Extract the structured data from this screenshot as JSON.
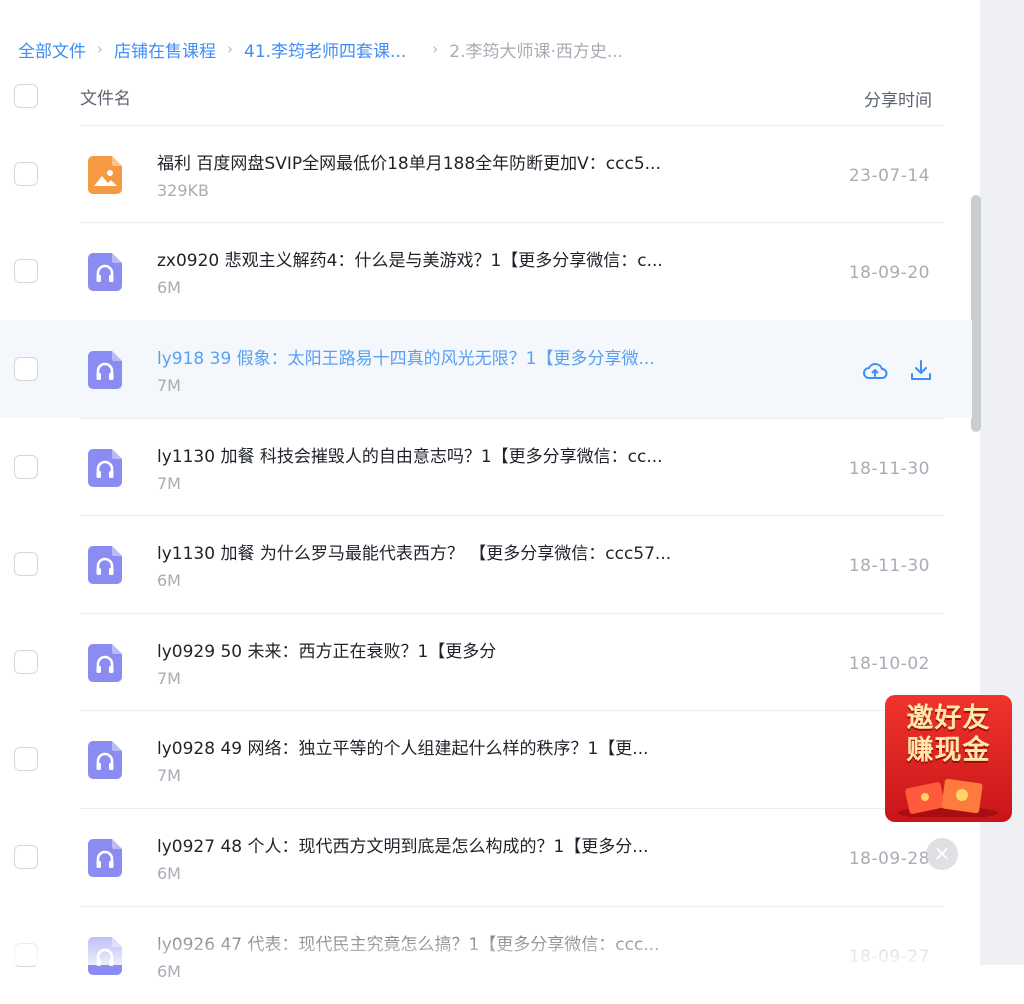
{
  "breadcrumb": [
    {
      "label": "全部文件"
    },
    {
      "label": "店铺在售课程"
    },
    {
      "label": "41.李筠老师四套课..."
    },
    {
      "label": "2.李筠大师课·西方史..."
    }
  ],
  "table_header": {
    "name": "文件名",
    "time": "分享时间"
  },
  "files": [
    {
      "name": "福利 百度网盘SVIP全网最低价18单月188全年防断更加V：ccc5...",
      "size": "329KB",
      "time": "23-07-14",
      "type": "image"
    },
    {
      "name": "zx0920 悲观主义解药4：什么是与美游戏？1【更多分享微信：c...",
      "size": "6M",
      "time": "18-09-20",
      "type": "audio"
    },
    {
      "name": "ly918 39 假象：太阳王路易十四真的风光无限？1【更多分享微...",
      "size": "7M",
      "time": "",
      "type": "audio",
      "hovered": true
    },
    {
      "name": "ly1130 加餐 科技会摧毁人的自由意志吗？1【更多分享微信：cc...",
      "size": "7M",
      "time": "18-11-30",
      "type": "audio"
    },
    {
      "name": "ly1130 加餐 为什么罗马最能代表西方？ 【更多分享微信：ccc57...",
      "size": "6M",
      "time": "18-11-30",
      "type": "audio"
    },
    {
      "name": "ly0929 50 未来：西方正在衰败？1【更多分",
      "size": "7M",
      "time": "18-10-02",
      "type": "audio"
    },
    {
      "name": "ly0928 49 网络：独立平等的个人组建起什么样的秩序？1【更...",
      "size": "7M",
      "time": "18-0",
      "type": "audio"
    },
    {
      "name": "ly0927 48 个人：现代西方文明到底是怎么构成的？1【更多分...",
      "size": "6M",
      "time": "18-09-28",
      "type": "audio"
    },
    {
      "name": "ly0926 47 代表：现代民主究竟怎么搞？1【更多分享微信：ccc...",
      "size": "6M",
      "time": "18-09-27",
      "type": "audio"
    }
  ],
  "promo": {
    "line1": "邀好友",
    "line2": "赚现金"
  },
  "close_glyph": "×",
  "colors": {
    "link": "#3e8ef7",
    "hover_row_bg": "#f4f7fb",
    "audio_icon": "#8b8cf2",
    "image_icon": "#f59a43",
    "promo_red": "#e3262a"
  },
  "icons": {
    "save": "cloud-save-icon",
    "download": "download-icon"
  }
}
